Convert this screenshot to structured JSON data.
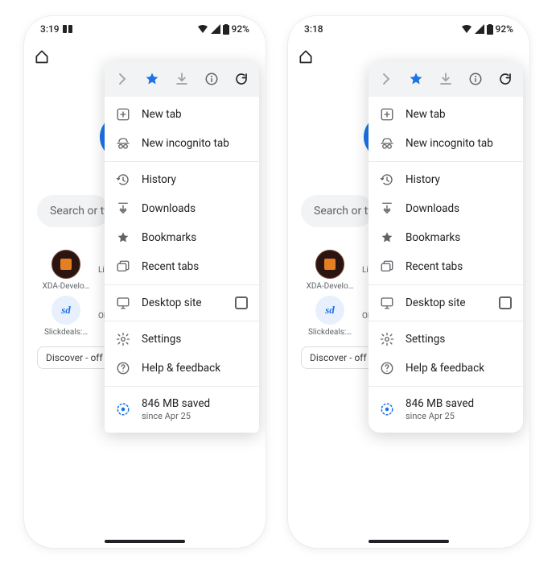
{
  "phones": [
    {
      "time": "3:19",
      "battery": "92%",
      "menu_rounded": false
    },
    {
      "time": "3:18",
      "battery": "92%",
      "menu_rounded": true
    }
  ],
  "background": {
    "search_placeholder": "Search or type",
    "shortcuts": [
      {
        "label": "XDA-Develo…",
        "sub": "Li"
      },
      {
        "label": "Slickdeals:…",
        "sub": "Ol"
      }
    ],
    "discover": "Discover - off"
  },
  "menu": {
    "items": [
      {
        "icon": "plus",
        "label": "New tab"
      },
      {
        "icon": "incognito",
        "label": "New incognito tab"
      },
      {
        "divider": true
      },
      {
        "icon": "history",
        "label": "History"
      },
      {
        "icon": "download",
        "label": "Downloads"
      },
      {
        "icon": "star",
        "label": "Bookmarks"
      },
      {
        "icon": "tabs",
        "label": "Recent tabs"
      },
      {
        "divider": true
      },
      {
        "icon": "desktop",
        "label": "Desktop site",
        "checkbox": true
      },
      {
        "divider": true
      },
      {
        "icon": "gear",
        "label": "Settings"
      },
      {
        "icon": "help",
        "label": "Help & feedback"
      },
      {
        "divider": true
      },
      {
        "icon": "data",
        "label": "846 MB saved",
        "sub": "since Apr 25",
        "blue_icon": true
      }
    ]
  }
}
